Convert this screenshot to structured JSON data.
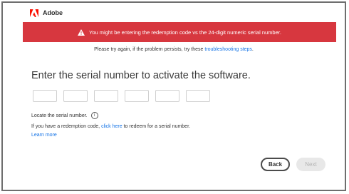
{
  "header": {
    "brand": "Adobe"
  },
  "banner": {
    "message": "You might be entering the redemption code vs the 24-digit numeric serial number.",
    "color": "#d7373f"
  },
  "retry": {
    "text": "Please try again, if the problem persists, try these ",
    "link": "troubleshooting steps",
    "suffix": "."
  },
  "main": {
    "heading": "Enter the serial number to activate the software.",
    "serial_fields": [
      "",
      "",
      "",
      "",
      "",
      ""
    ],
    "locate_label": "Locate the serial number.",
    "info_icon": "i",
    "redeem_prefix": "If you have a redemption code, ",
    "redeem_link": "click here",
    "redeem_suffix": " to redeem for a serial number.",
    "learn_more": "Learn more"
  },
  "buttons": {
    "back": "Back",
    "next": "Next"
  },
  "colors": {
    "link": "#1473e6",
    "brand": "#fa0f00"
  }
}
